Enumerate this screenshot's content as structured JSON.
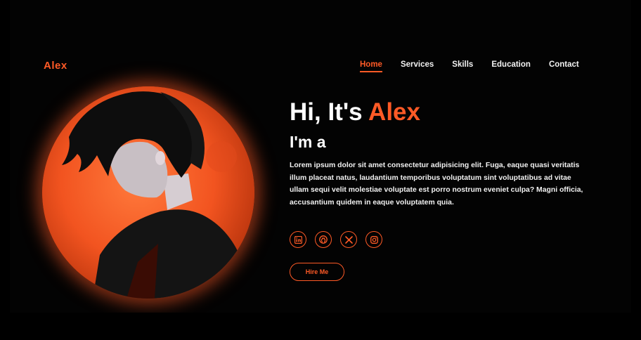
{
  "close_button": {
    "icon": "close-icon"
  },
  "logo": "Alex",
  "nav": {
    "items": [
      {
        "label": "Home",
        "active": true
      },
      {
        "label": "Services",
        "active": false
      },
      {
        "label": "Skills",
        "active": false
      },
      {
        "label": "Education",
        "active": false
      },
      {
        "label": "Contact",
        "active": false
      }
    ]
  },
  "hero": {
    "greeting_prefix": "Hi, It's ",
    "greeting_name": "Alex",
    "subtitle": "I'm a",
    "description": "Lorem ipsum dolor sit amet consectetur adipisicing elit. Fuga, eaque quasi veritatis illum placeat natus, laudantium temporibus voluptatum sint voluptatibus ad vitae ullam sequi velit molestiae voluptate est porro nostrum eveniet culpa? Magni officia, accusantium quidem in eaque voluptatem quia.",
    "cta_label": "Hire Me"
  },
  "socials": [
    {
      "icon": "linkedin-icon"
    },
    {
      "icon": "github-icon"
    },
    {
      "icon": "x-twitter-icon"
    },
    {
      "icon": "instagram-icon"
    }
  ],
  "colors": {
    "accent": "#ff5a26",
    "background": "#000000",
    "text": "#ffffff"
  }
}
